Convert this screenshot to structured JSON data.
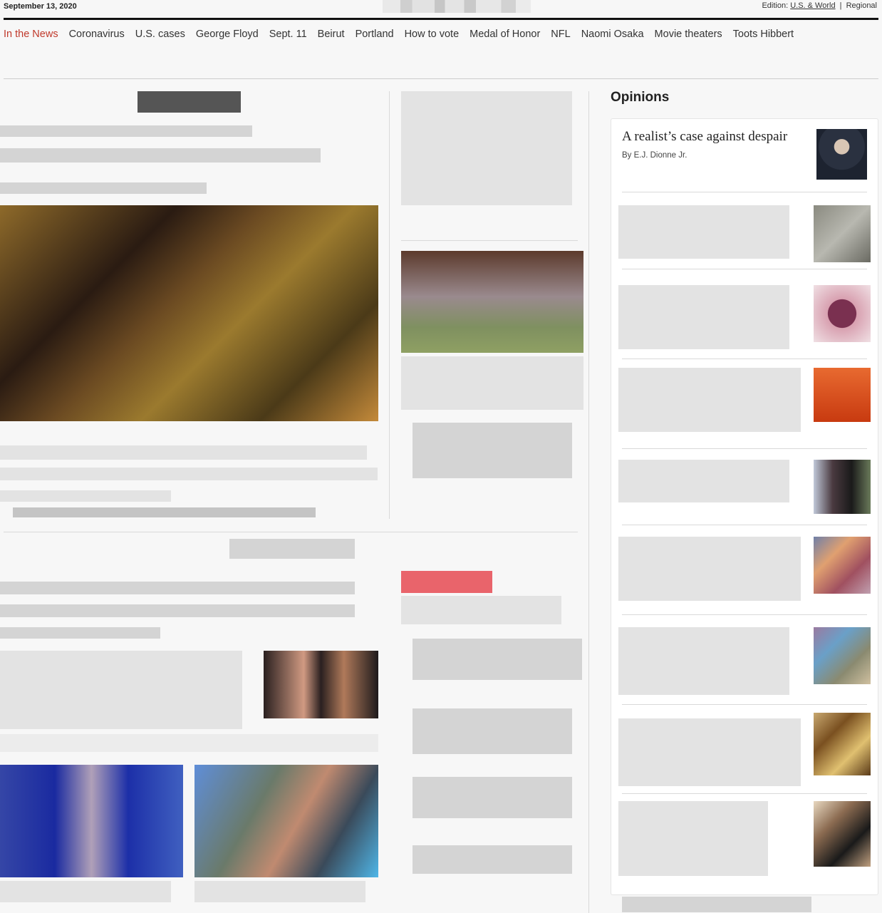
{
  "header": {
    "date": "September 13, 2020",
    "edition_label": "Edition:",
    "edition_world": "U.S. & World",
    "edition_sep": "|",
    "edition_regional": "Regional"
  },
  "nav": {
    "lead": "In the News",
    "items": [
      "Coronavirus",
      "U.S. cases",
      "George Floyd",
      "Sept. 11",
      "Beirut",
      "Portland",
      "How to vote",
      "Medal of Honor",
      "NFL",
      "Naomi Osaka",
      "Movie theaters",
      "Toots Hibbert"
    ]
  },
  "opinions": {
    "heading": "Opinions",
    "feature": {
      "title": "A realist’s case against despair",
      "byline": "By E.J. Dionne Jr."
    }
  },
  "colors": {
    "accent_red": "#c0392b",
    "tag_red": "#e9646b",
    "rule_dark": "#111111"
  }
}
